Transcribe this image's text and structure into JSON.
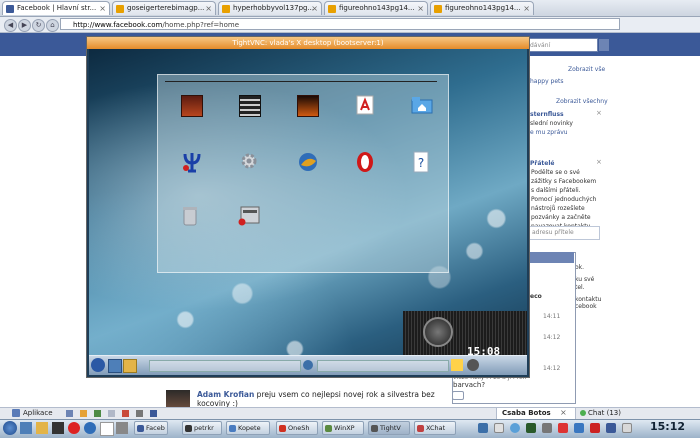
{
  "browser": {
    "tabs": [
      {
        "label": "Facebook | Hlavní str...",
        "fav": "#3b5998",
        "active": true
      },
      {
        "label": "goseigerterebimagp...",
        "fav": "#e8a000",
        "active": false
      },
      {
        "label": "hyperhobbyvol137pg...",
        "fav": "#e8a000",
        "active": false
      },
      {
        "label": "figureohno143pg14...",
        "fav": "#e8a000",
        "active": false
      },
      {
        "label": "figureohno143pg14...",
        "fav": "#e8a000",
        "active": false
      }
    ],
    "url_host": "http://www.facebook.com",
    "url_path": "/home.php?ref=home"
  },
  "facebook": {
    "search_placeholder": "dávání",
    "right_column": {
      "show_all_1": "Zobrazit vše",
      "happy_pets": "happy pets",
      "show_all_2": "Zobrazit všechny",
      "sternfluss": "sternfluss",
      "latest_news": "slední novinky",
      "send_message": "e mu zprávu",
      "friends_heading": "Přátelé",
      "friends_text_1": "Podělte se o své",
      "friends_text_2": "zážitky s Facebookem",
      "friends_text_3": "s dalšími přáteli.",
      "friends_text_4": "Pomocí jednoduchých",
      "friends_text_5": "nástrojů rozešlete",
      "friends_text_6": "pozvánky a začněte",
      "friends_text_7": "navazovat kontakty.",
      "email_placeholder": "adresu přítele",
      "side_1": "ok.",
      "side_2": "ku své",
      "side_3": "tel.",
      "side_4": "kontaktu",
      "side_5": "cebook"
    },
    "chat_popup": {
      "partial_name": "eco",
      "times": [
        "14:11",
        "14:12",
        "14:12"
      ],
      "message_1": "vícze řížky i i ze a jí i řen",
      "message_2": "barvach?",
      "user": "Csaba Botos"
    },
    "feed": {
      "author": "Adam Krofian",
      "text_1": " preju vsem co nejlepsi novej rok a silvestra bez",
      "text_2": "kocoviny :)"
    },
    "chatbar": {
      "apps_label": "Aplikace",
      "chat_label": "Chat (13)"
    }
  },
  "vnc": {
    "title": "TightVNC: vlada's X desktop (bootserver:1)",
    "clock": "15:08"
  },
  "os_taskbar": {
    "tasks": [
      {
        "label": "Faceb",
        "color": "#3b5998"
      },
      {
        "label": "petrkr",
        "color": "#333333"
      },
      {
        "label": "Kopete",
        "color": "#4a7cc0"
      },
      {
        "label": "OneSh",
        "color": "#d03020"
      },
      {
        "label": "WinXP",
        "color": "#5a8a40"
      },
      {
        "label": "TightV",
        "color": "#555555"
      },
      {
        "label": "XChat",
        "color": "#c04040"
      }
    ],
    "clock": "15:12"
  }
}
